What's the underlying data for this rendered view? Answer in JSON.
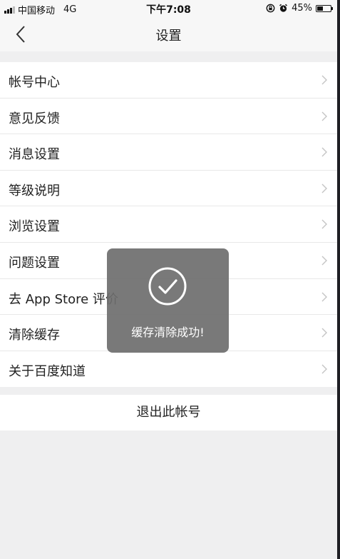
{
  "status_bar": {
    "carrier": "中国移动",
    "network": "4G",
    "time": "下午7:08",
    "battery": "45%",
    "battery_level": 0.45,
    "icons": [
      "signal-icon",
      "lock-rotation-icon",
      "alarm-icon",
      "battery-icon"
    ]
  },
  "nav": {
    "title": "设置",
    "back_icon": "chevron-left-icon"
  },
  "settings_items": [
    {
      "label": "帐号中心"
    },
    {
      "label": "意见反馈"
    },
    {
      "label": "消息设置"
    },
    {
      "label": "等级说明"
    },
    {
      "label": "浏览设置"
    },
    {
      "label": "问题设置"
    },
    {
      "label": "去 App Store 评价"
    },
    {
      "label": "清除缓存"
    },
    {
      "label": "关于百度知道"
    }
  ],
  "logout_label": "退出此帐号",
  "toast": {
    "message": "缓存清除成功!",
    "icon": "check-circle-icon"
  },
  "colors": {
    "background": "#efeff0",
    "toast_bg": "#6e6e6e",
    "text": "#222222"
  }
}
